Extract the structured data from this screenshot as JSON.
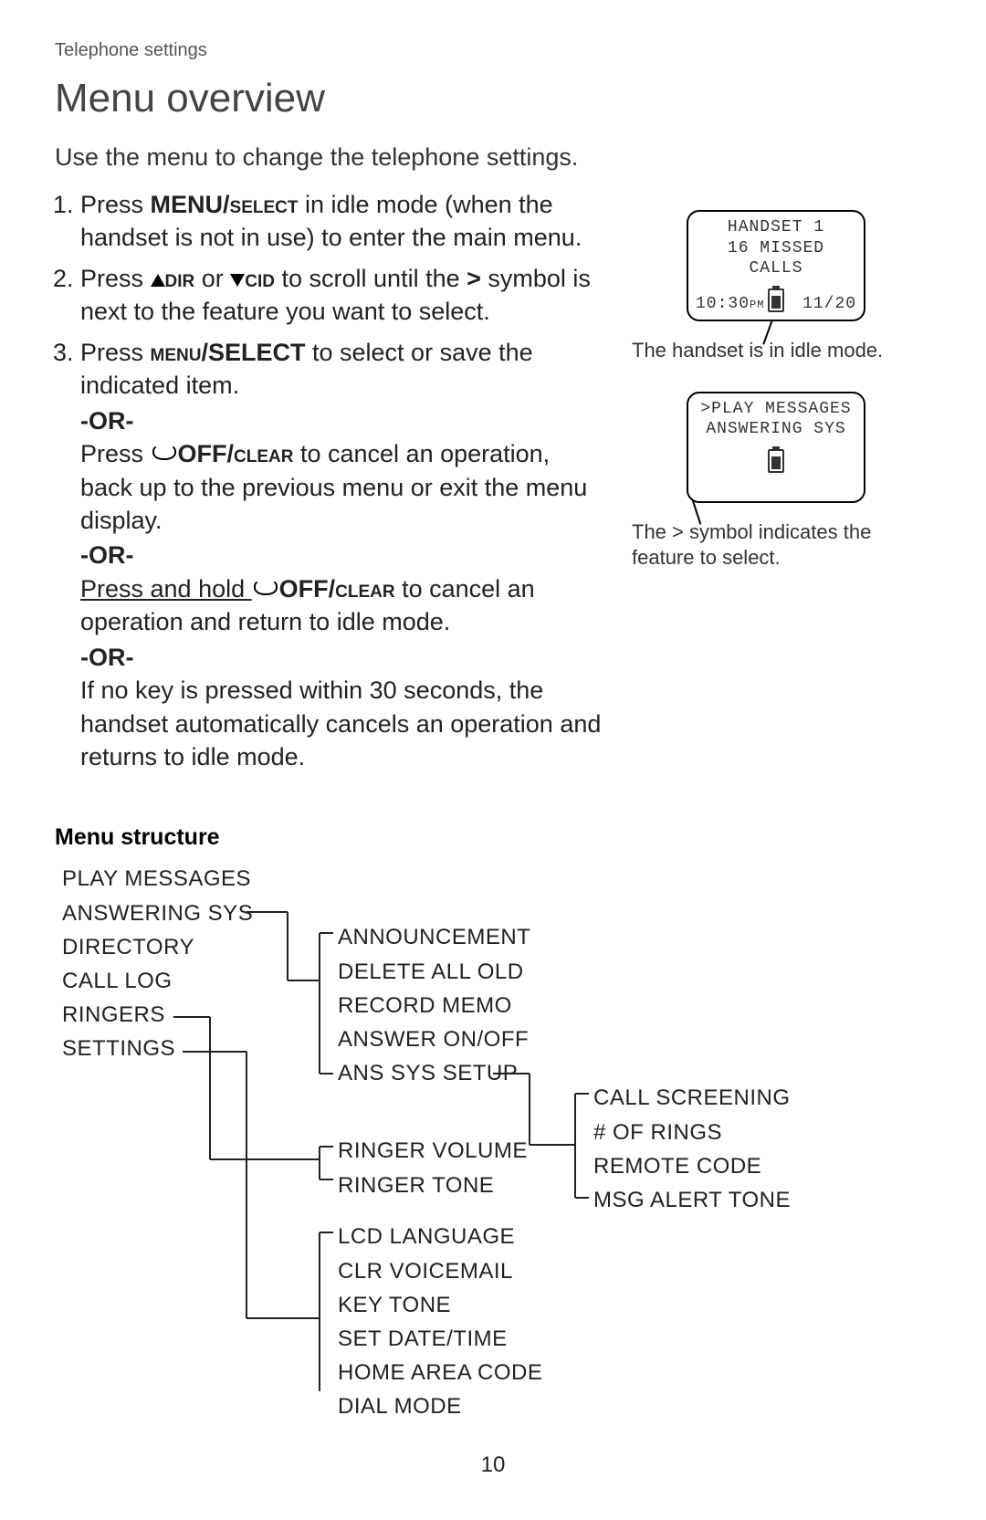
{
  "header": {
    "section": "Telephone settings"
  },
  "title": "Menu overview",
  "intro": "Use the menu to change the telephone settings.",
  "steps": {
    "s1a": "Press ",
    "s1b": "MENU/",
    "s1c": "select",
    "s1d": " in idle mode (when the handset is not in use) to enter the main menu.",
    "s2a": "Press ",
    "s2b": "dir",
    "s2c": " or ",
    "s2d": "cid",
    "s2e": " to scroll until the ",
    "s2f": ">",
    "s2g": " symbol is next to the feature you want to select.",
    "s3a": "Press ",
    "s3b": "menu",
    "s3c": "/SELECT",
    "s3d": " to select or save the indicated item.",
    "or": "-OR-",
    "s3e": "Press ",
    "s3f": "OFF/",
    "s3g": "clear",
    "s3h": " to cancel an operation, back up to the previous menu or exit the menu display.",
    "s3i": "Press and hold ",
    "s3j": "OFF/",
    "s3k": "clear",
    "s3l": " to cancel an operation and return to idle mode.",
    "s3m": "If no key is pressed within 30 seconds, the handset automatically cancels an operation and returns to idle mode."
  },
  "lcd1": {
    "line1": "HANDSET 1",
    "line2": "16 MISSED CALLS",
    "time": "10:30",
    "ampm": "PM",
    "date": "11/20",
    "caption": "The handset is in idle mode."
  },
  "lcd2": {
    "line1": ">PLAY MESSAGES",
    "line2": " ANSWERING SYS",
    "caption": "The > symbol indicates the feature to select."
  },
  "menu": {
    "heading": "Menu structure",
    "col1": [
      "PLAY MESSAGES",
      "ANSWERING SYS",
      "DIRECTORY",
      "CALL LOG",
      "RINGERS",
      "SETTINGS"
    ],
    "col2_ans": [
      "ANNOUNCEMENT",
      "DELETE ALL OLD",
      "RECORD MEMO",
      "ANSWER ON/OFF",
      "ANS SYS SETUP"
    ],
    "col2_ring": [
      "RINGER VOLUME",
      "RINGER TONE"
    ],
    "col2_set": [
      "LCD LANGUAGE",
      "CLR VOICEMAIL",
      "KEY TONE",
      "SET DATE/TIME",
      "HOME AREA CODE",
      "DIAL MODE"
    ],
    "col3": [
      "CALL SCREENING",
      "# OF RINGS",
      "REMOTE CODE",
      "MSG ALERT TONE"
    ]
  },
  "page_number": "10"
}
